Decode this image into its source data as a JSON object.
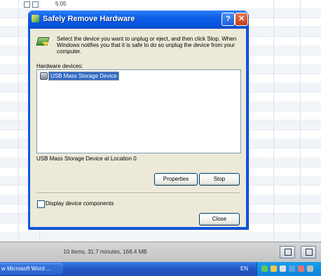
{
  "background": {
    "top_row_time": "5:05"
  },
  "dialog": {
    "title": "Safely Remove Hardware",
    "help_button": "?",
    "close_button": "✕",
    "instructions": "Select the device you want to unplug or eject, and then click Stop. When Windows notifies you that it is safe to do so unplug the device from your computer.",
    "hardware_devices_label": "Hardware devices:",
    "devices": [
      {
        "label": "USB Mass Storage Device",
        "selected": true,
        "icon": "usb-device-icon"
      }
    ],
    "location_text": "USB Mass Storage Device at Location 0",
    "properties_button": "Properties",
    "stop_button": "Stop",
    "display_components_label": "Display device components",
    "display_components_checked": false,
    "close_label": "Close"
  },
  "statusbar": {
    "summary": "10 items, 31.7 minutes, 168.4 MB"
  },
  "taskbar": {
    "task_label": "w Microsoft Word ...",
    "language": "EN"
  },
  "colors": {
    "titlebar": "#0c5ce8",
    "dialog_bg": "#ece9d8",
    "selection": "#316ac5",
    "taskbar": "#2458c5",
    "tray": "#0d84d8"
  }
}
